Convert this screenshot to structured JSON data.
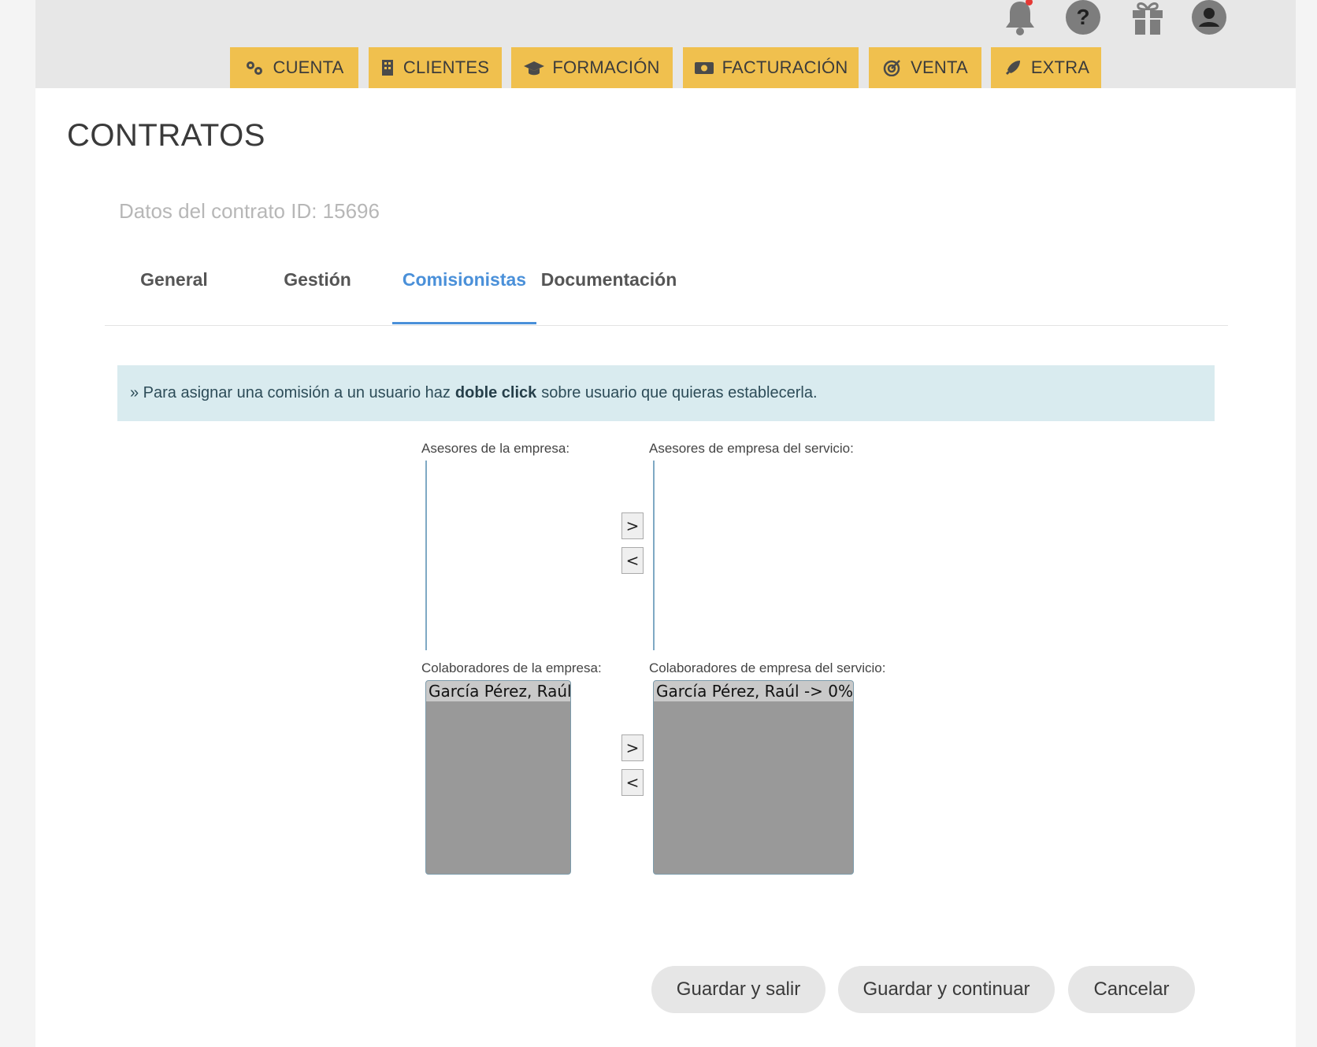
{
  "top_icons": [
    {
      "icon": "bell-icon",
      "has_notification": true,
      "notification_color": "#e53935"
    },
    {
      "icon": "help-icon",
      "glyph": "?"
    },
    {
      "icon": "gift-icon"
    },
    {
      "icon": "user-avatar-icon"
    }
  ],
  "nav": {
    "accent_color": "#f0c04e",
    "items": [
      {
        "label": "CUENTA",
        "icon": "gears-icon"
      },
      {
        "label": "CLIENTES",
        "icon": "building-icon"
      },
      {
        "label": "FORMACIÓN",
        "icon": "graduation-cap-icon"
      },
      {
        "label": "FACTURACIÓN",
        "icon": "money-icon"
      },
      {
        "label": "VENTA",
        "icon": "target-icon"
      },
      {
        "label": "EXTRA",
        "icon": "rocket-icon"
      }
    ]
  },
  "page": {
    "title": "CONTRATOS",
    "subtitle": "Datos del contrato ID: 15696"
  },
  "tabs": {
    "items": [
      "General",
      "Gestión",
      "Comisionistas",
      "Documentación"
    ],
    "active": "Comisionistas",
    "active_color": "#4a90d9"
  },
  "info": {
    "prefix": "» Para asignar una comisión a un usuario haz",
    "bold": "doble click",
    "suffix": "sobre usuario que quieras establecerla."
  },
  "asesores": {
    "left_label": "Asesores de la empresa:",
    "right_label": "Asesores de empresa del servicio:",
    "left_options": [],
    "right_options": []
  },
  "colaboradores": {
    "left_label": "Colaboradores de la empresa:",
    "right_label": "Colaboradores de empresa del servicio:",
    "left_options": [
      "García Pérez, Raúl"
    ],
    "right_options": [
      "García Pérez, Raúl -> 0%"
    ]
  },
  "move_buttons": {
    "right": ">",
    "left": "<"
  },
  "actions": {
    "save_exit": "Guardar y salir",
    "save_continue": "Guardar y continuar",
    "cancel": "Cancelar"
  }
}
